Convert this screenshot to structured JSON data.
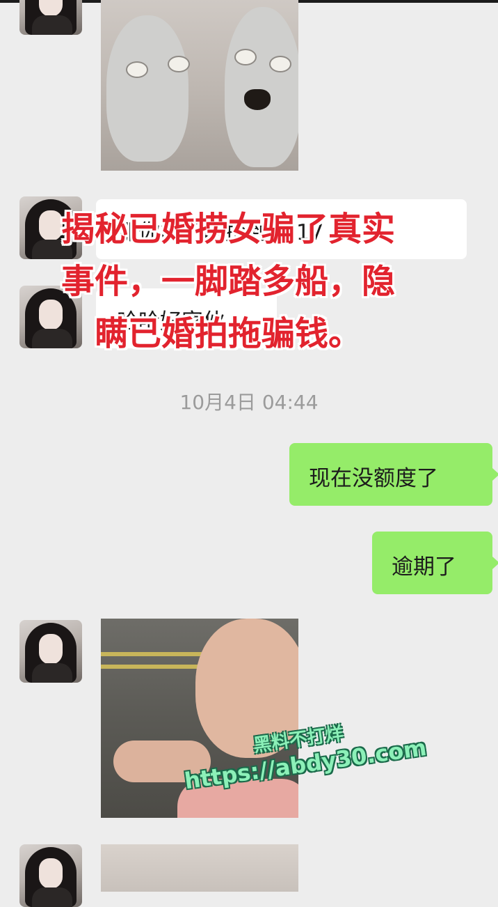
{
  "chat": {
    "messages": [
      {
        "side": "left",
        "text": "那你能不能抢到吗 17"
      },
      {
        "side": "left",
        "text": "哈哈好家伙"
      },
      {
        "side": "right",
        "text": "现在没额度了"
      },
      {
        "side": "right",
        "text": "逾期了"
      }
    ],
    "timestamp": "10月4日 04:44"
  },
  "overlay": {
    "headline": "揭秘已婚捞女骗了真实事件，一脚踏多船，隐瞒已婚拍拖骗钱。"
  },
  "watermark": {
    "line1": "黑料不打烊",
    "line2": "https://abdy30.com"
  },
  "colors": {
    "background": "#ededed",
    "incoming_bubble": "#ffffff",
    "outgoing_bubble": "#95ec69",
    "headline_red": "#e2232e",
    "watermark_green": "#8cf0b8"
  }
}
